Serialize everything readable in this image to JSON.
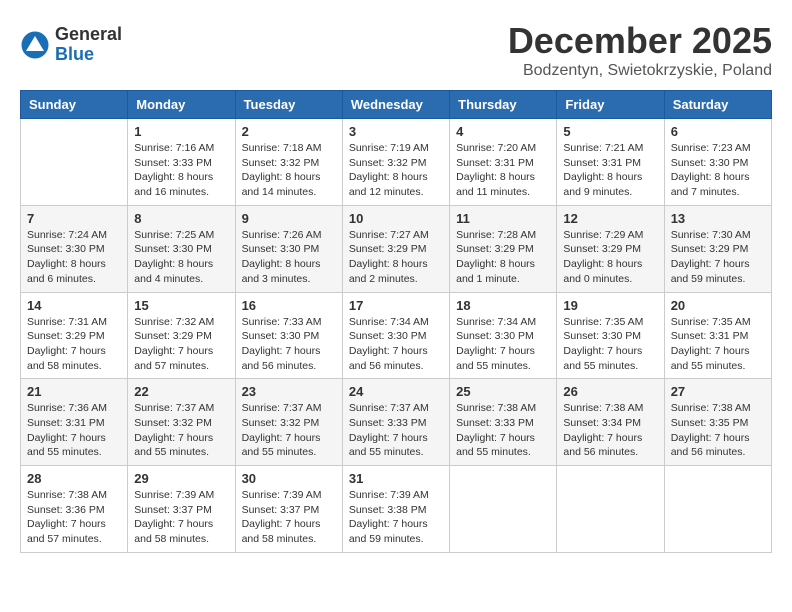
{
  "header": {
    "logo_general": "General",
    "logo_blue": "Blue",
    "month_title": "December 2025",
    "location": "Bodzentyn, Swietokrzyskie, Poland"
  },
  "weekdays": [
    "Sunday",
    "Monday",
    "Tuesday",
    "Wednesday",
    "Thursday",
    "Friday",
    "Saturday"
  ],
  "weeks": [
    [
      {
        "day": "",
        "sunrise": "",
        "sunset": "",
        "daylight": ""
      },
      {
        "day": "1",
        "sunrise": "Sunrise: 7:16 AM",
        "sunset": "Sunset: 3:33 PM",
        "daylight": "Daylight: 8 hours and 16 minutes."
      },
      {
        "day": "2",
        "sunrise": "Sunrise: 7:18 AM",
        "sunset": "Sunset: 3:32 PM",
        "daylight": "Daylight: 8 hours and 14 minutes."
      },
      {
        "day": "3",
        "sunrise": "Sunrise: 7:19 AM",
        "sunset": "Sunset: 3:32 PM",
        "daylight": "Daylight: 8 hours and 12 minutes."
      },
      {
        "day": "4",
        "sunrise": "Sunrise: 7:20 AM",
        "sunset": "Sunset: 3:31 PM",
        "daylight": "Daylight: 8 hours and 11 minutes."
      },
      {
        "day": "5",
        "sunrise": "Sunrise: 7:21 AM",
        "sunset": "Sunset: 3:31 PM",
        "daylight": "Daylight: 8 hours and 9 minutes."
      },
      {
        "day": "6",
        "sunrise": "Sunrise: 7:23 AM",
        "sunset": "Sunset: 3:30 PM",
        "daylight": "Daylight: 8 hours and 7 minutes."
      }
    ],
    [
      {
        "day": "7",
        "sunrise": "Sunrise: 7:24 AM",
        "sunset": "Sunset: 3:30 PM",
        "daylight": "Daylight: 8 hours and 6 minutes."
      },
      {
        "day": "8",
        "sunrise": "Sunrise: 7:25 AM",
        "sunset": "Sunset: 3:30 PM",
        "daylight": "Daylight: 8 hours and 4 minutes."
      },
      {
        "day": "9",
        "sunrise": "Sunrise: 7:26 AM",
        "sunset": "Sunset: 3:30 PM",
        "daylight": "Daylight: 8 hours and 3 minutes."
      },
      {
        "day": "10",
        "sunrise": "Sunrise: 7:27 AM",
        "sunset": "Sunset: 3:29 PM",
        "daylight": "Daylight: 8 hours and 2 minutes."
      },
      {
        "day": "11",
        "sunrise": "Sunrise: 7:28 AM",
        "sunset": "Sunset: 3:29 PM",
        "daylight": "Daylight: 8 hours and 1 minute."
      },
      {
        "day": "12",
        "sunrise": "Sunrise: 7:29 AM",
        "sunset": "Sunset: 3:29 PM",
        "daylight": "Daylight: 8 hours and 0 minutes."
      },
      {
        "day": "13",
        "sunrise": "Sunrise: 7:30 AM",
        "sunset": "Sunset: 3:29 PM",
        "daylight": "Daylight: 7 hours and 59 minutes."
      }
    ],
    [
      {
        "day": "14",
        "sunrise": "Sunrise: 7:31 AM",
        "sunset": "Sunset: 3:29 PM",
        "daylight": "Daylight: 7 hours and 58 minutes."
      },
      {
        "day": "15",
        "sunrise": "Sunrise: 7:32 AM",
        "sunset": "Sunset: 3:29 PM",
        "daylight": "Daylight: 7 hours and 57 minutes."
      },
      {
        "day": "16",
        "sunrise": "Sunrise: 7:33 AM",
        "sunset": "Sunset: 3:30 PM",
        "daylight": "Daylight: 7 hours and 56 minutes."
      },
      {
        "day": "17",
        "sunrise": "Sunrise: 7:34 AM",
        "sunset": "Sunset: 3:30 PM",
        "daylight": "Daylight: 7 hours and 56 minutes."
      },
      {
        "day": "18",
        "sunrise": "Sunrise: 7:34 AM",
        "sunset": "Sunset: 3:30 PM",
        "daylight": "Daylight: 7 hours and 55 minutes."
      },
      {
        "day": "19",
        "sunrise": "Sunrise: 7:35 AM",
        "sunset": "Sunset: 3:30 PM",
        "daylight": "Daylight: 7 hours and 55 minutes."
      },
      {
        "day": "20",
        "sunrise": "Sunrise: 7:35 AM",
        "sunset": "Sunset: 3:31 PM",
        "daylight": "Daylight: 7 hours and 55 minutes."
      }
    ],
    [
      {
        "day": "21",
        "sunrise": "Sunrise: 7:36 AM",
        "sunset": "Sunset: 3:31 PM",
        "daylight": "Daylight: 7 hours and 55 minutes."
      },
      {
        "day": "22",
        "sunrise": "Sunrise: 7:37 AM",
        "sunset": "Sunset: 3:32 PM",
        "daylight": "Daylight: 7 hours and 55 minutes."
      },
      {
        "day": "23",
        "sunrise": "Sunrise: 7:37 AM",
        "sunset": "Sunset: 3:32 PM",
        "daylight": "Daylight: 7 hours and 55 minutes."
      },
      {
        "day": "24",
        "sunrise": "Sunrise: 7:37 AM",
        "sunset": "Sunset: 3:33 PM",
        "daylight": "Daylight: 7 hours and 55 minutes."
      },
      {
        "day": "25",
        "sunrise": "Sunrise: 7:38 AM",
        "sunset": "Sunset: 3:33 PM",
        "daylight": "Daylight: 7 hours and 55 minutes."
      },
      {
        "day": "26",
        "sunrise": "Sunrise: 7:38 AM",
        "sunset": "Sunset: 3:34 PM",
        "daylight": "Daylight: 7 hours and 56 minutes."
      },
      {
        "day": "27",
        "sunrise": "Sunrise: 7:38 AM",
        "sunset": "Sunset: 3:35 PM",
        "daylight": "Daylight: 7 hours and 56 minutes."
      }
    ],
    [
      {
        "day": "28",
        "sunrise": "Sunrise: 7:38 AM",
        "sunset": "Sunset: 3:36 PM",
        "daylight": "Daylight: 7 hours and 57 minutes."
      },
      {
        "day": "29",
        "sunrise": "Sunrise: 7:39 AM",
        "sunset": "Sunset: 3:37 PM",
        "daylight": "Daylight: 7 hours and 58 minutes."
      },
      {
        "day": "30",
        "sunrise": "Sunrise: 7:39 AM",
        "sunset": "Sunset: 3:37 PM",
        "daylight": "Daylight: 7 hours and 58 minutes."
      },
      {
        "day": "31",
        "sunrise": "Sunrise: 7:39 AM",
        "sunset": "Sunset: 3:38 PM",
        "daylight": "Daylight: 7 hours and 59 minutes."
      },
      {
        "day": "",
        "sunrise": "",
        "sunset": "",
        "daylight": ""
      },
      {
        "day": "",
        "sunrise": "",
        "sunset": "",
        "daylight": ""
      },
      {
        "day": "",
        "sunrise": "",
        "sunset": "",
        "daylight": ""
      }
    ]
  ]
}
